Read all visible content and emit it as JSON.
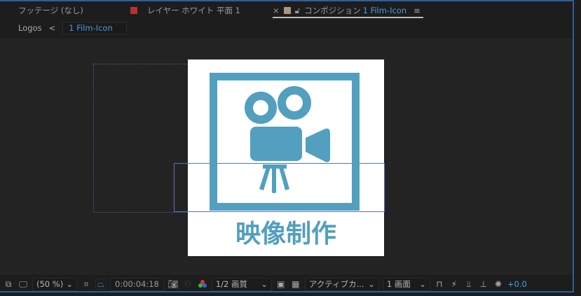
{
  "tabs": [
    {
      "label": "フッテージ (なし)"
    },
    {
      "label": "レイヤー ホワイト 平面 1",
      "swatch": "#b83232"
    },
    {
      "label": "コンポジション",
      "comp_name": "1 Film-Icon",
      "swatch": "#a8977a",
      "close": "×",
      "menu": "≡"
    }
  ],
  "breadcrumb": {
    "parent": "Logos",
    "arrow": "<",
    "current": "1 Film-Icon"
  },
  "canvas": {
    "caption": "映像制作",
    "accent": "#529fbf"
  },
  "toolbar": {
    "zoom": "(50 %)",
    "timecode": "0:00:04:18",
    "resolution": "1/2 画質",
    "camera": "アクティブカ...",
    "views": "1 画面",
    "exposure": "+0.0",
    "chevron": "⌄"
  }
}
